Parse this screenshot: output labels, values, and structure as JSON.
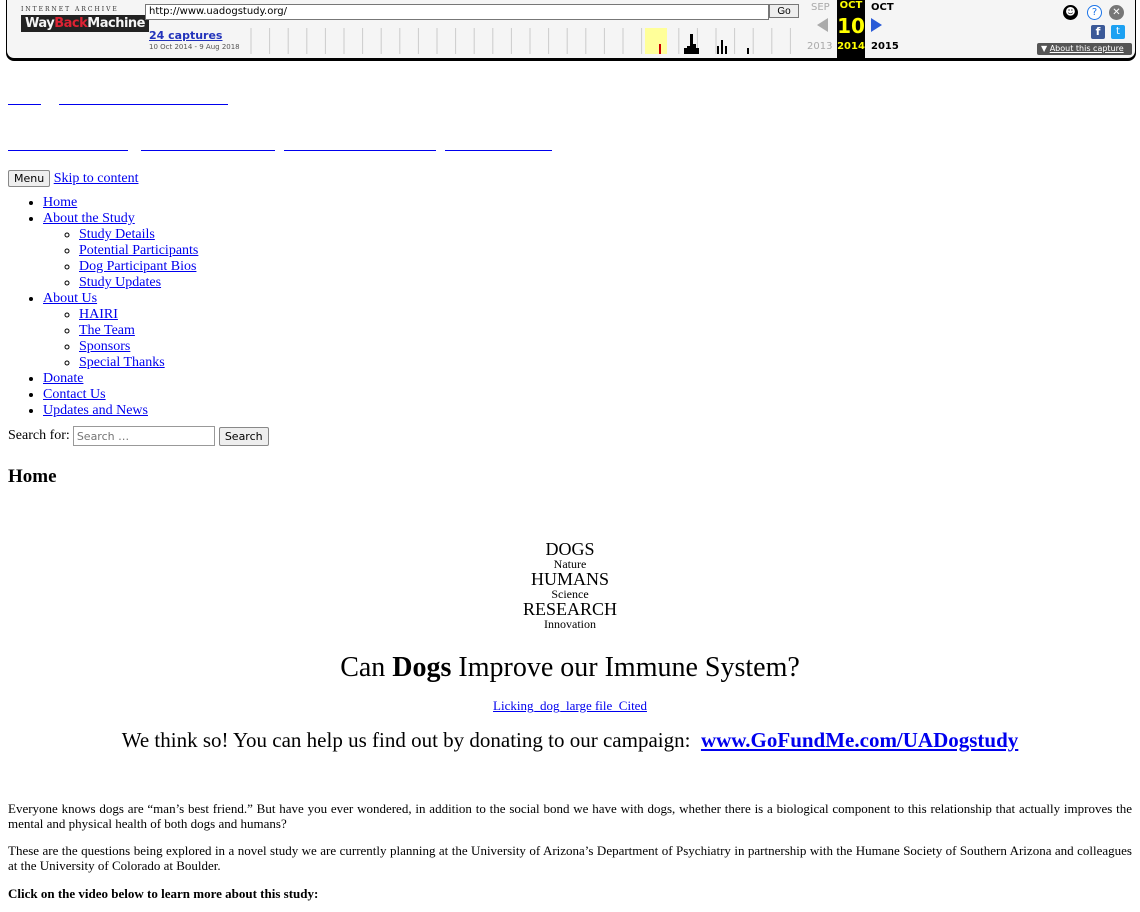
{
  "wayback": {
    "logo_top": "INTERNET ARCHIVE",
    "logo_way": "Way",
    "logo_back": "Back",
    "logo_machine": "Machine",
    "url": "http://www.uadogstudy.org/",
    "go_label": "Go",
    "captures": "24 captures",
    "date_range": "10 Oct 2014 - 9 Aug 2018",
    "prev_month": "SEP",
    "cur_month": "OCT",
    "next_month": "OCT",
    "day": "10",
    "prev_year": "2013",
    "cur_year": "2014",
    "next_year": "2015",
    "about_label": "About this capture",
    "capture_bars": [
      0,
      0,
      0,
      0,
      0,
      0,
      0,
      0,
      0,
      0,
      0,
      0,
      0,
      0,
      0,
      0,
      0,
      0,
      0,
      0,
      0,
      0,
      0,
      0,
      0,
      0,
      0,
      0,
      0,
      0,
      0,
      0,
      0,
      0,
      0,
      0,
      0,
      0,
      0,
      0,
      0,
      0,
      0,
      0,
      0,
      0,
      0,
      0,
      0,
      0,
      0,
      0,
      0,
      0,
      0,
      0,
      0,
      0,
      0,
      0,
      0,
      0,
      0,
      0,
      0,
      0,
      0,
      0,
      0,
      0,
      0,
      0,
      0,
      0,
      0,
      0,
      0,
      0,
      0,
      0,
      0,
      0,
      0,
      0,
      0,
      0,
      0,
      0,
      0,
      0,
      0,
      0,
      0,
      0,
      0,
      0,
      0,
      0,
      0,
      0,
      0,
      0,
      0,
      0,
      0,
      0,
      0,
      0,
      0,
      0,
      0,
      0,
      0,
      0,
      0,
      0,
      0,
      0,
      0,
      0,
      0,
      0,
      0,
      0,
      0,
      0,
      0,
      0,
      0,
      0,
      0,
      0,
      0,
      0,
      0,
      0,
      0,
      0,
      0,
      0,
      0,
      0,
      0,
      0,
      0,
      0,
      0,
      0,
      0,
      0,
      0,
      0,
      0,
      0,
      0,
      0,
      0,
      0,
      0,
      0,
      0,
      0,
      0,
      0,
      0,
      0,
      0,
      0,
      0,
      0,
      0,
      0,
      0,
      0,
      0,
      0,
      0,
      0,
      0,
      0,
      0,
      0,
      0,
      0,
      0,
      0,
      0,
      0,
      0,
      0,
      0,
      0,
      0,
      0,
      0,
      0,
      0,
      0,
      0,
      0,
      0,
      0,
      0,
      0,
      0,
      0,
      0,
      0,
      0,
      0,
      0,
      0,
      0,
      0,
      0,
      0,
      0,
      0,
      0,
      0,
      0,
      0,
      0,
      0,
      0,
      0,
      0,
      0,
      0,
      0,
      0,
      0,
      0,
      0,
      0,
      0,
      0,
      0,
      0,
      0,
      0,
      0,
      0,
      0,
      0,
      0,
      0,
      0,
      0,
      0,
      0,
      0,
      0,
      0,
      0,
      0,
      0,
      0,
      0,
      0,
      0,
      0,
      0,
      0,
      0,
      0,
      0,
      0,
      0,
      0,
      0,
      0,
      0,
      0,
      0,
      0,
      0,
      0,
      0,
      0,
      0,
      0,
      0,
      0,
      0,
      0,
      0,
      0,
      0,
      0,
      0,
      0,
      0,
      0,
      0,
      0,
      0,
      0,
      0,
      0,
      0,
      0,
      0,
      0,
      0,
      0,
      0,
      0,
      0,
      0,
      0,
      0,
      0,
      0,
      0,
      0,
      0,
      0,
      0,
      0,
      0,
      0,
      0,
      0,
      0,
      0,
      0,
      0,
      0,
      0,
      0,
      0,
      0,
      0,
      0,
      0,
      0,
      0,
      0,
      0,
      0,
      0,
      0,
      0,
      0,
      0,
      0,
      0,
      0,
      0,
      0,
      0,
      0,
      0,
      0,
      0,
      0,
      0,
      0,
      0,
      0,
      0,
      0,
      0,
      0,
      0,
      0,
      0,
      0,
      0,
      0,
      0,
      0,
      0,
      0,
      0,
      0,
      0,
      0,
      0,
      0,
      0,
      0,
      0,
      0,
      0,
      0,
      0,
      0,
      0,
      0,
      0,
      0,
      0,
      0,
      0,
      0,
      0,
      0,
      0,
      0,
      0,
      0,
      0,
      0,
      0,
      0,
      0,
      0,
      0,
      0,
      0,
      0,
      0,
      0,
      0,
      0,
      0,
      0,
      0,
      0,
      0,
      0,
      0,
      0,
      0,
      0,
      0,
      0,
      0,
      0,
      0,
      0,
      0,
      0,
      0,
      0,
      0,
      0,
      0,
      0,
      0,
      0,
      0,
      0,
      0,
      0,
      0,
      0,
      0,
      0,
      0,
      0,
      0,
      0,
      0,
      0,
      0,
      0,
      0,
      0,
      0,
      0,
      0,
      0,
      0,
      0,
      0,
      0,
      0,
      0,
      0,
      0,
      0,
      0,
      0,
      0,
      0,
      0,
      0,
      0,
      0,
      0,
      0,
      0,
      0,
      0,
      0,
      0,
      0,
      0,
      0,
      0,
      0,
      0,
      0,
      0,
      0,
      0,
      0,
      0,
      0,
      0,
      0,
      0,
      0,
      0,
      0,
      0,
      0,
      0,
      0,
      0,
      0,
      0,
      0,
      0,
      0,
      0,
      0,
      0,
      0,
      0,
      0,
      0,
      0,
      0,
      0,
      0,
      0,
      0,
      0,
      0,
      0,
      0,
      0,
      0,
      0,
      0,
      0,
      0,
      0,
      0,
      0,
      0,
      0,
      0,
      0,
      0,
      0,
      0,
      0,
      0,
      0,
      0,
      0,
      0,
      0,
      0,
      0,
      0,
      0,
      0,
      0,
      0,
      0,
      0,
      0,
      0,
      0,
      0,
      0,
      0,
      0,
      0,
      0,
      0,
      0,
      0,
      0,
      0,
      0,
      0,
      0,
      0,
      0,
      0,
      0,
      0,
      0,
      0,
      0,
      0,
      0,
      0,
      0,
      0,
      0,
      0,
      0,
      0,
      0,
      0,
      0,
      0,
      0,
      0,
      0,
      0,
      0,
      0,
      0,
      0
    ],
    "highlight_color": "#ffff99",
    "selected_color": "#cc0000",
    "accent": "#2a5bd7"
  },
  "nav": {
    "menu_label": "Menu",
    "skip_label": "Skip to content",
    "items": [
      {
        "label": "Home"
      },
      {
        "label": "About the Study",
        "children": [
          "Study Details",
          "Potential Participants",
          "Dog Participant Bios",
          "Study Updates"
        ]
      },
      {
        "label": "About Us",
        "children": [
          "HAIRI",
          "The Team",
          "Sponsors",
          "Special Thanks"
        ]
      },
      {
        "label": "Donate"
      },
      {
        "label": "Contact Us"
      },
      {
        "label": "Updates and News"
      }
    ]
  },
  "search": {
    "label": "Search for:",
    "placeholder": "Search …",
    "button": "Search"
  },
  "page": {
    "title": "Home",
    "tagline": [
      "DOGS",
      "Nature",
      "HUMANS",
      "Science",
      "RESEARCH",
      "Innovation"
    ],
    "headline_pre": "Can ",
    "headline_bold": "Dogs",
    "headline_post": " Improve our Immune System?",
    "image_alt": "Licking_dog_large file_Cited",
    "donate_text": "We think so! You can help us find out by donating to our campaign:  ",
    "donate_link": "www.GoFundMe.com/UADogstudy",
    "para1": "Everyone knows dogs are “man’s best friend.” But have you ever wondered, in addition to the social bond we have with dogs, whether there is a biological component to this relationship that actually improves the mental and physical health of both dogs and humans?",
    "para2": "These are the questions being explored in a novel study we are currently planning at the University of Arizona’s Department of Psychiatry in partnership with the Humane Society of Southern Arizona and colleagues at the University of Colorado at Boulder.",
    "para3": "Click on the video below to learn more about this study:"
  }
}
